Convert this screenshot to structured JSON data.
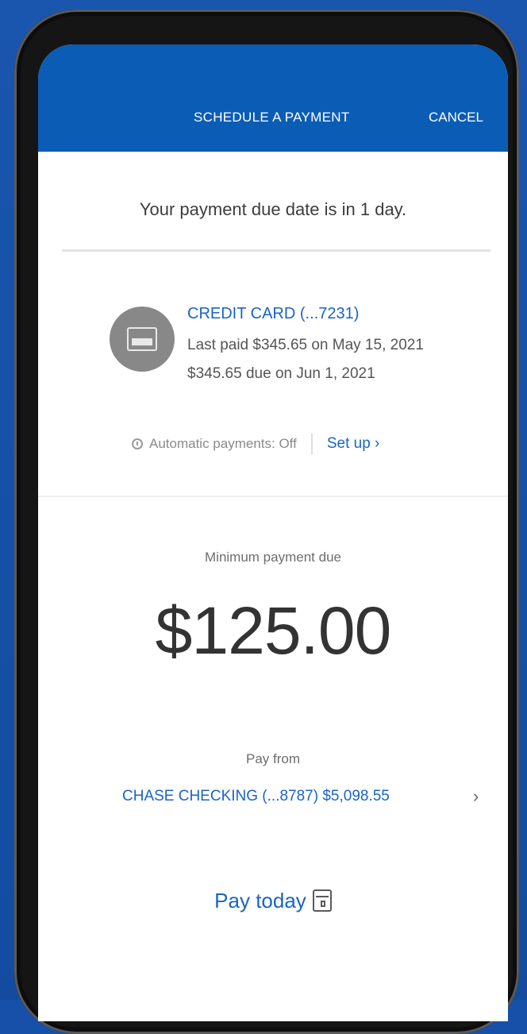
{
  "header": {
    "title": "SCHEDULE A PAYMENT",
    "cancel_label": "CANCEL"
  },
  "due_note": "Your payment due date is in 1 day.",
  "account": {
    "name": "CREDIT CARD (...7231)",
    "last_paid": "Last paid $345.65 on May 15, 2021",
    "due": "$345.65 due on Jun 1, 2021",
    "icon": "credit-card-icon"
  },
  "autopay": {
    "status": "Automatic payments: Off",
    "setup_label": "Set up ›",
    "icon": "info-icon"
  },
  "minimum_payment": {
    "label": "Minimum payment due",
    "amount": "$125.00"
  },
  "pay_from": {
    "label": "Pay from",
    "account": "CHASE CHECKING (...8787) $5,098.55",
    "chevron": "›"
  },
  "pay_date": {
    "label": "Pay today",
    "icon": "calendar-icon"
  },
  "colors": {
    "brand_blue": "#0b5cb5",
    "link_blue": "#1a64c4"
  }
}
